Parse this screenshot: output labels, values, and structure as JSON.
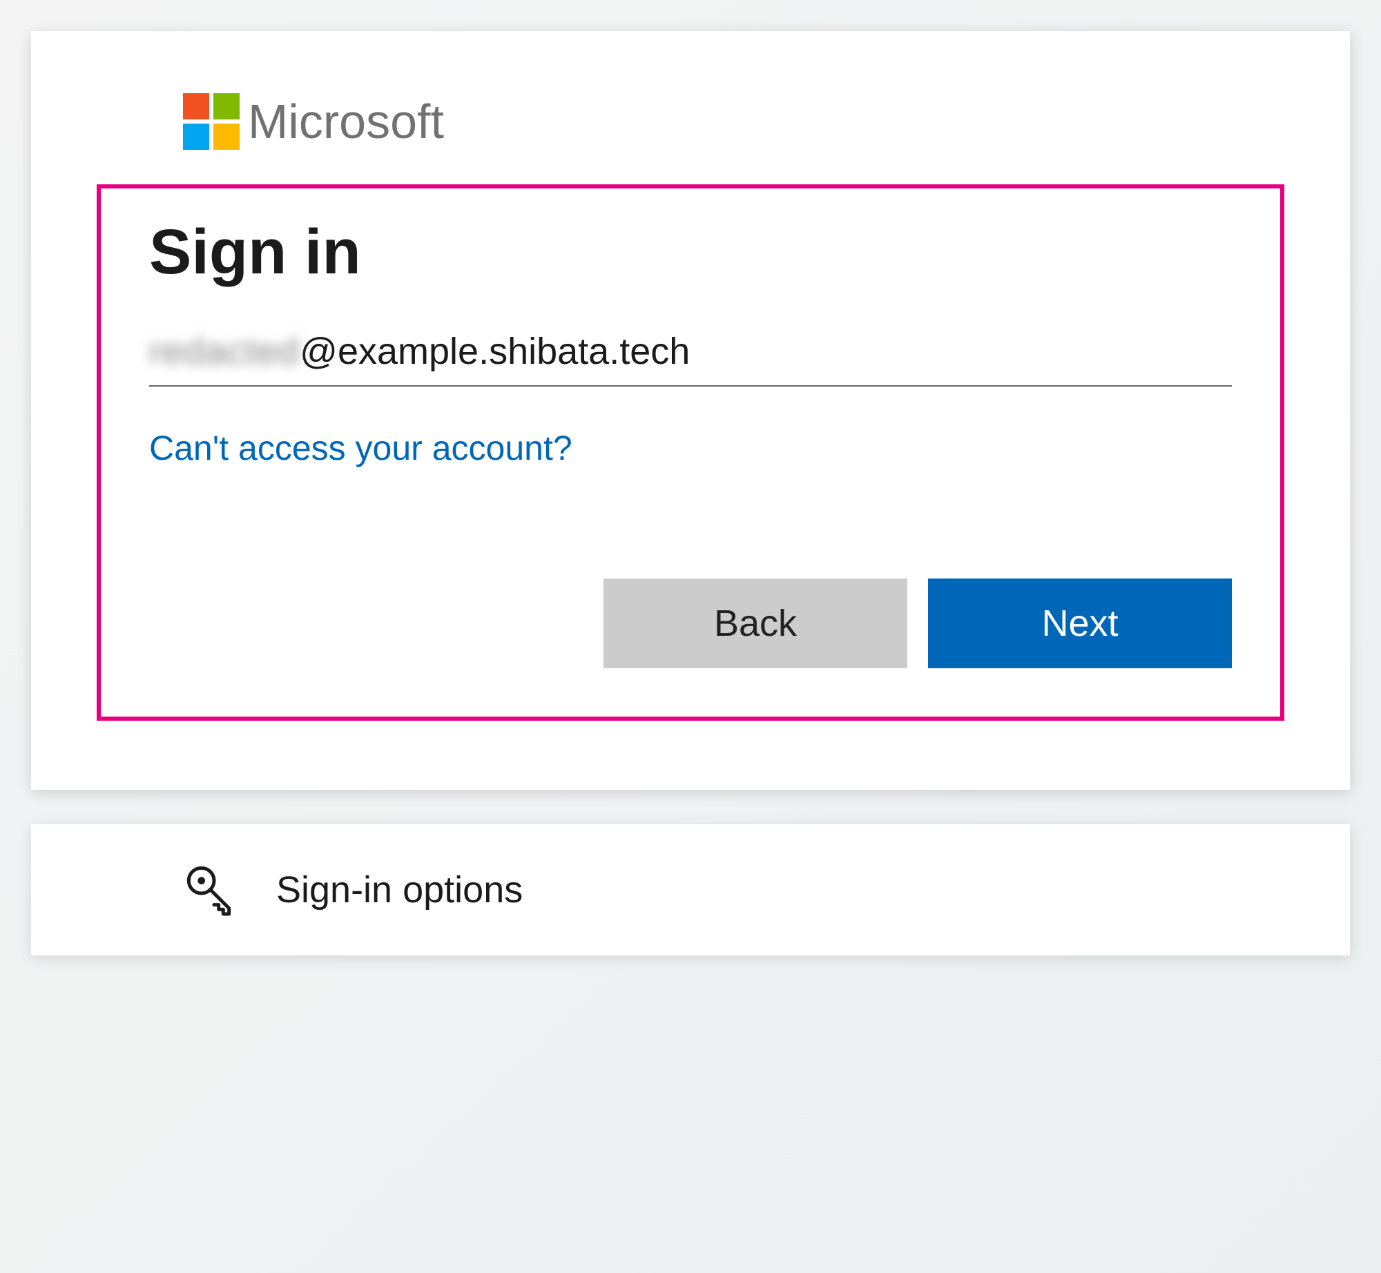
{
  "brand": "Microsoft",
  "title": "Sign in",
  "email_blurred_placeholder": "redacted",
  "email_visible": "@example.shibata.tech",
  "help_link": "Can't access your account?",
  "buttons": {
    "back": "Back",
    "next": "Next"
  },
  "signin_options": "Sign-in options",
  "colors": {
    "primary": "#0067b8",
    "highlight_border": "#e6007e",
    "secondary_button": "#cccccc"
  }
}
